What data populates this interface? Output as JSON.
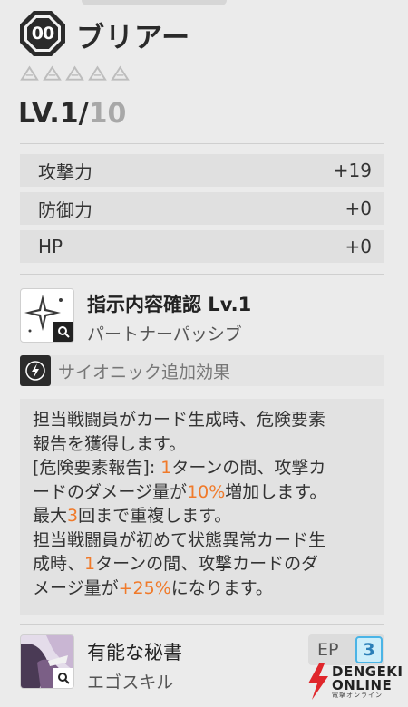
{
  "card": {
    "rarity_label": "00",
    "name": "ブリアー",
    "stars_total": 5,
    "stars_filled": 0,
    "level_current": "LV.1/",
    "level_max": "10"
  },
  "stats": [
    {
      "label": "攻撃力",
      "value": "+19"
    },
    {
      "label": "防御力",
      "value": "+0"
    },
    {
      "label": "HP",
      "value": "+0"
    }
  ],
  "skill": {
    "title": "指示内容確認 Lv.1",
    "subtitle": "パートナーパッシブ",
    "icon": "sparkle-star-icon"
  },
  "psionic": {
    "label": "サイオニック追加効果",
    "icon": "psionic-lightning-icon"
  },
  "description": {
    "line1": "担当戦闘員がカード生成時、危険要素",
    "line2": "報告を獲得します。",
    "line3_a": "[危険要素報告]: ",
    "line3_num": "1",
    "line3_b": "ターンの間、攻撃カ",
    "line4_a": "ードのダメージ量が",
    "line4_num": "10%",
    "line4_b": "増加します。",
    "line5_a": "最大",
    "line5_num": "3",
    "line5_b": "回まで重複します。",
    "line6": "担当戦闘員が初めて状態異常カード生",
    "line7_a": "成時、",
    "line7_num": "1",
    "line7_b": "ターンの間、攻撃カードのダ",
    "line8_a": "メージ量が",
    "line8_num": "+25%",
    "line8_b": "になります。",
    "highlight_color": "#f07a2a"
  },
  "ego": {
    "title": "有能な秘書",
    "subtitle": "エゴスキル",
    "ep_label": "EP",
    "ep_value": "3"
  },
  "watermark": {
    "line1": "DENGEKI",
    "line2": "ONLINE",
    "line3": "電撃オンライン"
  },
  "colors": {
    "accent_orange": "#f07a2a",
    "ep_blue": "#4ab4e6",
    "dark": "#2b2b2b"
  }
}
